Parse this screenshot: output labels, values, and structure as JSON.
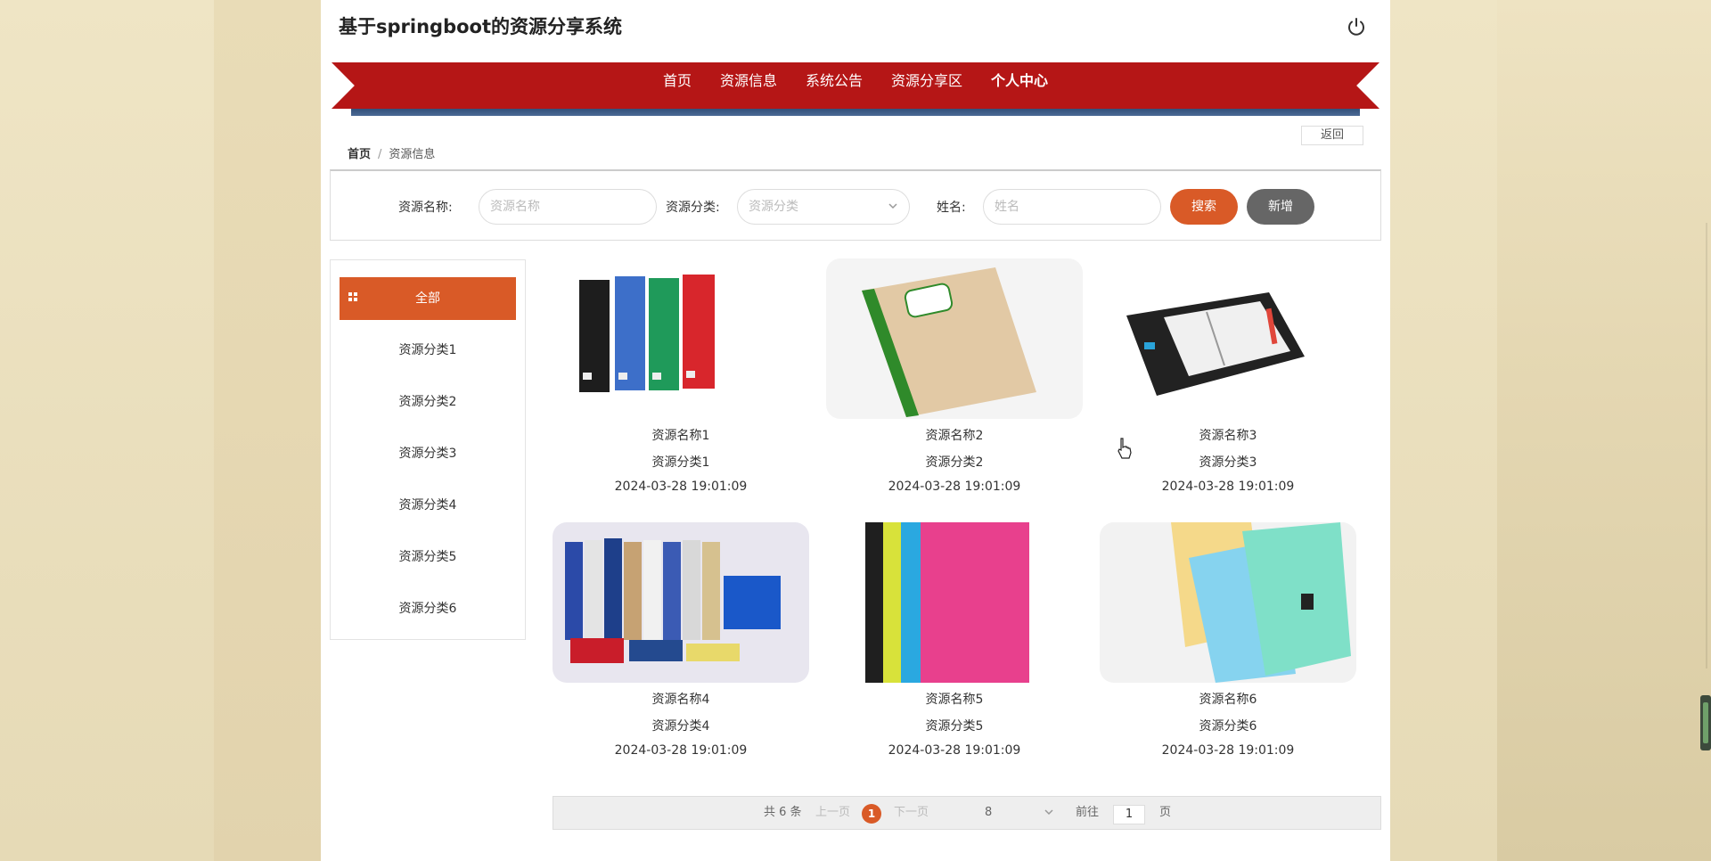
{
  "header": {
    "title": "基于springboot的资源分享系统"
  },
  "nav": {
    "items": [
      {
        "label": "首页"
      },
      {
        "label": "资源信息"
      },
      {
        "label": "系统公告"
      },
      {
        "label": "资源分享区"
      },
      {
        "label": "个人中心"
      }
    ]
  },
  "back_label": "返回",
  "breadcrumb": {
    "home": "首页",
    "separator": "/",
    "current": "资源信息"
  },
  "search": {
    "name_label": "资源名称:",
    "name_placeholder": "资源名称",
    "category_label": "资源分类:",
    "category_placeholder": "资源分类",
    "username_label": "姓名:",
    "username_placeholder": "姓名",
    "search_button": "搜索",
    "add_button": "新增"
  },
  "sidebar": {
    "items": [
      {
        "label": "全部"
      },
      {
        "label": "资源分类1"
      },
      {
        "label": "资源分类2"
      },
      {
        "label": "资源分类3"
      },
      {
        "label": "资源分类4"
      },
      {
        "label": "资源分类5"
      },
      {
        "label": "资源分类6"
      }
    ]
  },
  "resources": [
    {
      "name": "资源名称1",
      "category": "资源分类1",
      "time": "2024-03-28 19:01:09"
    },
    {
      "name": "资源名称2",
      "category": "资源分类2",
      "time": "2024-03-28 19:01:09"
    },
    {
      "name": "资源名称3",
      "category": "资源分类3",
      "time": "2024-03-28 19:01:09"
    },
    {
      "name": "资源名称4",
      "category": "资源分类4",
      "time": "2024-03-28 19:01:09"
    },
    {
      "name": "资源名称5",
      "category": "资源分类5",
      "time": "2024-03-28 19:01:09"
    },
    {
      "name": "资源名称6",
      "category": "资源分类6",
      "time": "2024-03-28 19:01:09"
    }
  ],
  "pagination": {
    "total": "共 6 条",
    "prev": "上一页",
    "current": "1",
    "next": "下一页",
    "page_size": "8",
    "goto_label": "前往",
    "goto_value": "1",
    "page_suffix": "页"
  },
  "colors": {
    "nav_red": "#b51616",
    "accent_orange": "#d95a27",
    "add_gray": "#666666"
  }
}
